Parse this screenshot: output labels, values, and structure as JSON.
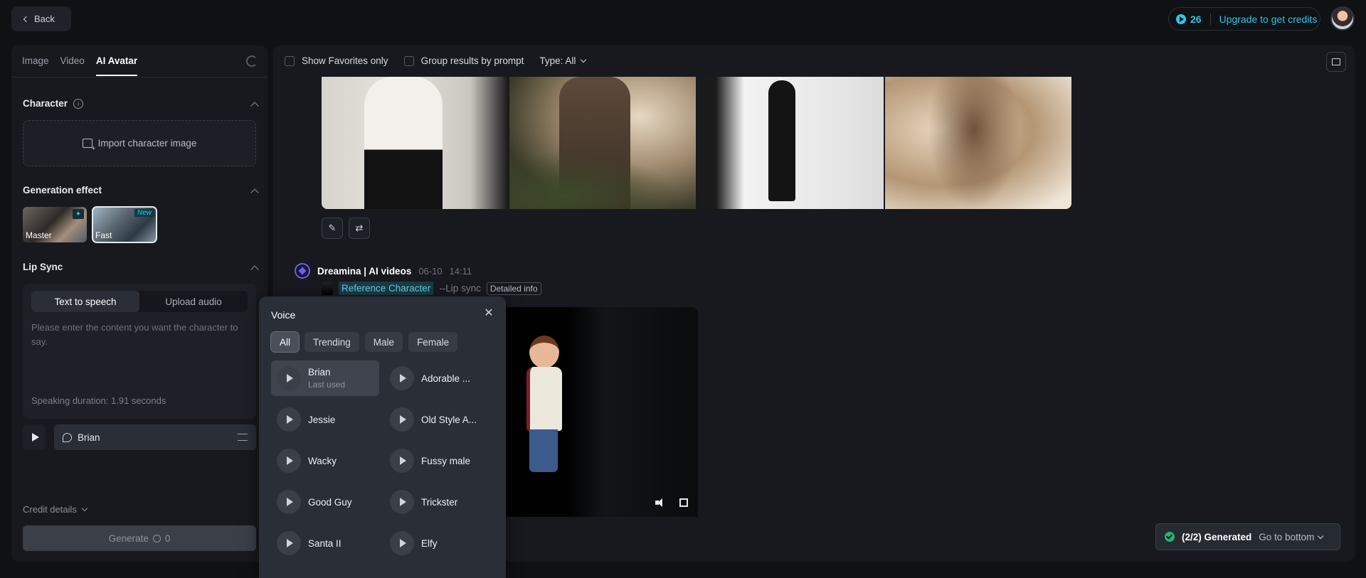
{
  "header": {
    "back_label": "Back",
    "credits": "26",
    "upgrade_label": "Upgrade to get credits"
  },
  "left_panel": {
    "tabs": [
      "Image",
      "Video",
      "AI Avatar"
    ],
    "active_tab": "AI Avatar",
    "character_title": "Character",
    "import_label": "Import character image",
    "generation_effect_title": "Generation effect",
    "effects": [
      {
        "label": "Master",
        "badge": "✦"
      },
      {
        "label": "Fast",
        "badge": "New"
      }
    ],
    "lip_sync_title": "Lip Sync",
    "lip_sync_modes": [
      "Text to speech",
      "Upload audio"
    ],
    "active_mode": "Text to speech",
    "text_placeholder": "Please enter the content you want the character to say.",
    "speaking_duration": "Speaking duration: 1.91 seconds",
    "selected_voice": "Brian",
    "credit_details_label": "Credit details",
    "generate_label": "Generate",
    "generate_cost": "0"
  },
  "main": {
    "show_favorites_label": "Show Favorites only",
    "group_results_label": "Group results by prompt",
    "type_filter_label": "Type: All",
    "generation": {
      "author": "Dreamina | AI videos",
      "date": "06-10",
      "time": "14:11",
      "reference_label": "Reference Character",
      "flag": "--Lip sync",
      "details_label": "Detailed info"
    },
    "status": {
      "count": "(2/2) Generated",
      "go_bottom_label": "Go to bottom"
    }
  },
  "voice_popup": {
    "title": "Voice",
    "filters": [
      "All",
      "Trending",
      "Male",
      "Female"
    ],
    "active_filter": "All",
    "voices": [
      {
        "name": "Brian",
        "sub": "Last used"
      },
      {
        "name": "Adorable ..."
      },
      {
        "name": "Jessie"
      },
      {
        "name": "Old Style A..."
      },
      {
        "name": "Wacky"
      },
      {
        "name": "Fussy male"
      },
      {
        "name": "Good Guy"
      },
      {
        "name": "Trickster"
      },
      {
        "name": "Santa II"
      },
      {
        "name": "Elfy"
      }
    ]
  },
  "colors": {
    "accent": "#2ec7e6",
    "brand_purple": "#6b5bff",
    "success": "#1fb57a"
  }
}
